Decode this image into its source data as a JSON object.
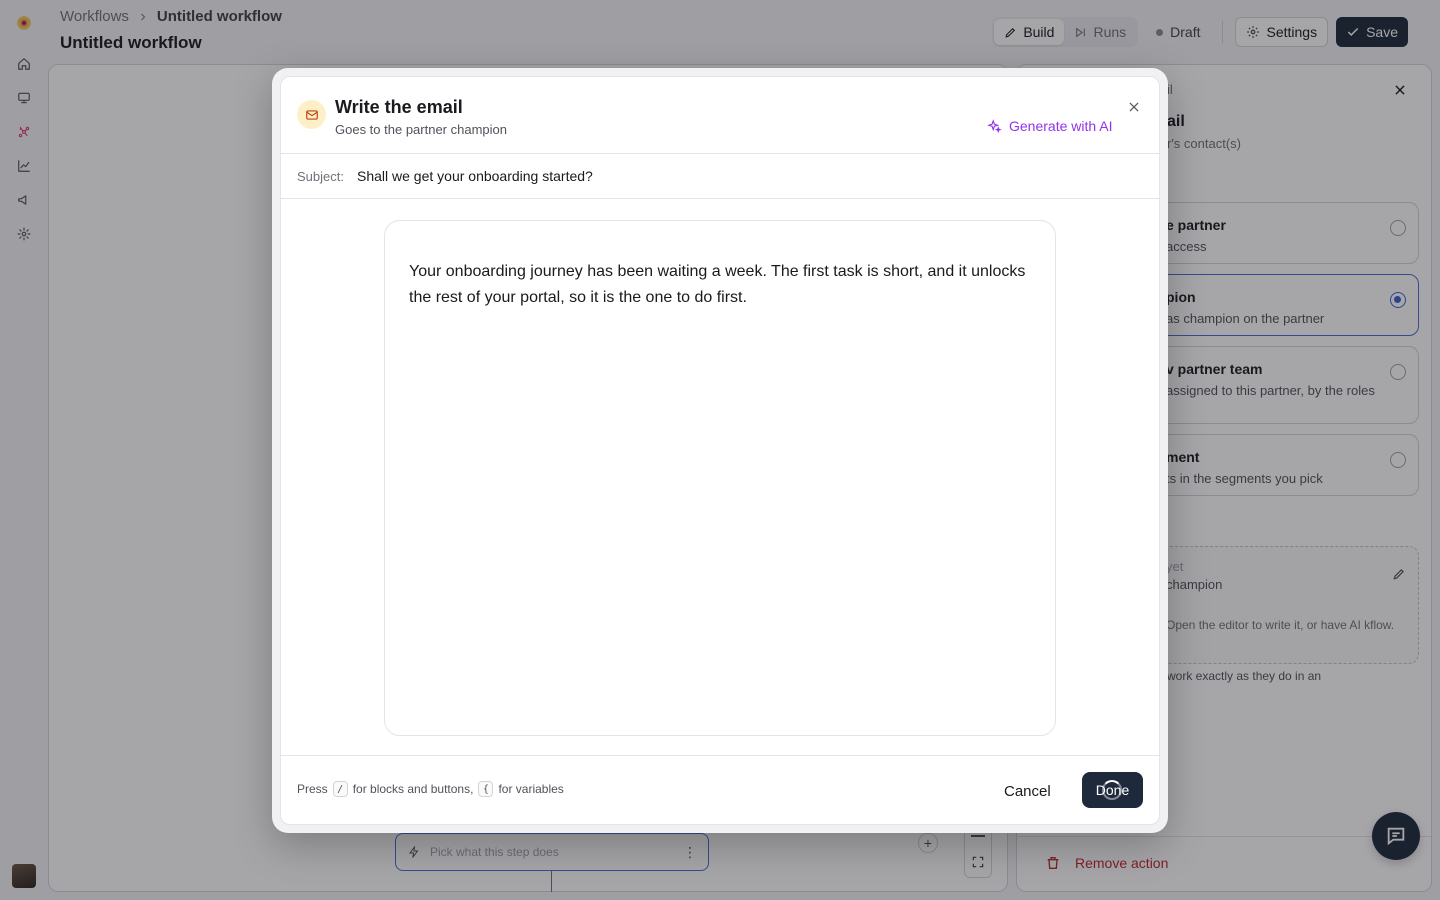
{
  "header": {
    "breadcrumb_root": "Workflows",
    "breadcrumb_current": "Untitled workflow",
    "title": "Untitled workflow",
    "tabs": [
      {
        "label": "Build",
        "icon": "pencil-icon",
        "active": true
      },
      {
        "label": "Runs",
        "icon": "play-skip-icon",
        "active": false
      }
    ],
    "status": "Draft",
    "settings_label": "Settings",
    "save_label": "Save"
  },
  "rail": {
    "items": [
      "logo-icon",
      "home-icon",
      "monitor-icon",
      "network-icon",
      "chart-icon",
      "megaphone-icon",
      "gear-icon"
    ]
  },
  "canvas": {
    "step_placeholder": "Pick what this step does",
    "add_label": "+"
  },
  "panel": {
    "crumb": "il",
    "heading": "ail",
    "heading_sub": "r's contact(s)",
    "options": [
      {
        "title": "e partner",
        "desc": "access",
        "selected": false
      },
      {
        "title": "pion",
        "desc": "as champion on the partner",
        "selected": true
      },
      {
        "title": "v partner team",
        "desc": "assigned to this partner, by the roles",
        "selected": false
      },
      {
        "title": "ment",
        "desc": "ts in the segments you pick",
        "selected": false
      }
    ],
    "draft_state": "yet",
    "draft_target": "champion",
    "draft_help": "Open the editor to write it, or have AI kflow.",
    "note": "work exactly as they do in an",
    "remove_label": "Remove action"
  },
  "modal": {
    "title": "Write the email",
    "subtitle": "Goes to the partner champion",
    "ai_label": "Generate with AI",
    "subject_label": "Subject:",
    "subject_value": "Shall we get your onboarding started?",
    "body": "Your onboarding journey has been waiting a week. The first task is short, and it unlocks the rest of your portal, so it is the one to do first.",
    "hint_press": "Press",
    "hint_key1": "/",
    "hint_mid": "for blocks and buttons,",
    "hint_key2": "{",
    "hint_end": "for variables",
    "cancel_label": "Cancel",
    "done_label": "Done"
  },
  "colors": {
    "primary_dark": "#1e2a3c",
    "accent_ai": "#9333ea",
    "selected_blue": "#3b5fd4",
    "danger": "#c2282c"
  }
}
